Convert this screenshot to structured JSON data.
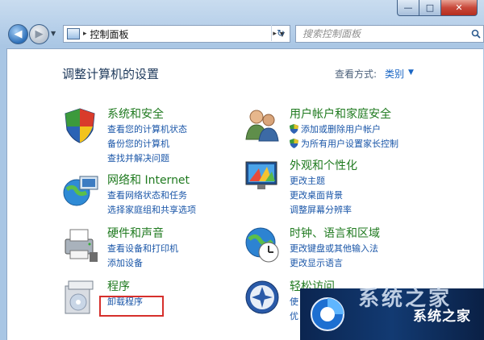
{
  "window": {
    "minimize_glyph": "—",
    "maximize_glyph": "□",
    "close_glyph": "✕"
  },
  "nav": {
    "back_glyph": "◀",
    "forward_glyph": "▶",
    "address_arrow": "▸",
    "address_text": "控制面板",
    "address_separator": "▸",
    "refresh_glyph": "↻",
    "search_placeholder": "搜索控制面板"
  },
  "page": {
    "title": "调整计算机的设置",
    "view_by_label": "查看方式:",
    "view_by_value": "类别"
  },
  "categories": [
    {
      "title": "系统和安全",
      "links": [
        "查看您的计算机状态",
        "备份您的计算机",
        "查找并解决问题"
      ]
    },
    {
      "title": "网络和 Internet",
      "links": [
        "查看网络状态和任务",
        "选择家庭组和共享选项"
      ]
    },
    {
      "title": "硬件和声音",
      "links": [
        "查看设备和打印机",
        "添加设备"
      ]
    },
    {
      "title": "程序",
      "links": [
        "卸载程序"
      ]
    },
    {
      "title": "用户帐户和家庭安全",
      "links": [
        "添加或删除用户帐户",
        "为所有用户设置家长控制"
      ]
    },
    {
      "title": "外观和个性化",
      "links": [
        "更改主题",
        "更改桌面背景",
        "调整屏幕分辨率"
      ]
    },
    {
      "title": "时钟、语言和区域",
      "links": [
        "更改键盘或其他输入法",
        "更改显示语言"
      ]
    },
    {
      "title": "轻松访问",
      "links": [
        "使",
        "优"
      ]
    }
  ],
  "watermark": {
    "big_text": "系统之家",
    "site_name": "系统之家"
  },
  "colors": {
    "category_title": "#1f7a1f",
    "link": "#1a56a8",
    "highlight_box": "#d6302c",
    "title": "#1e395b"
  }
}
